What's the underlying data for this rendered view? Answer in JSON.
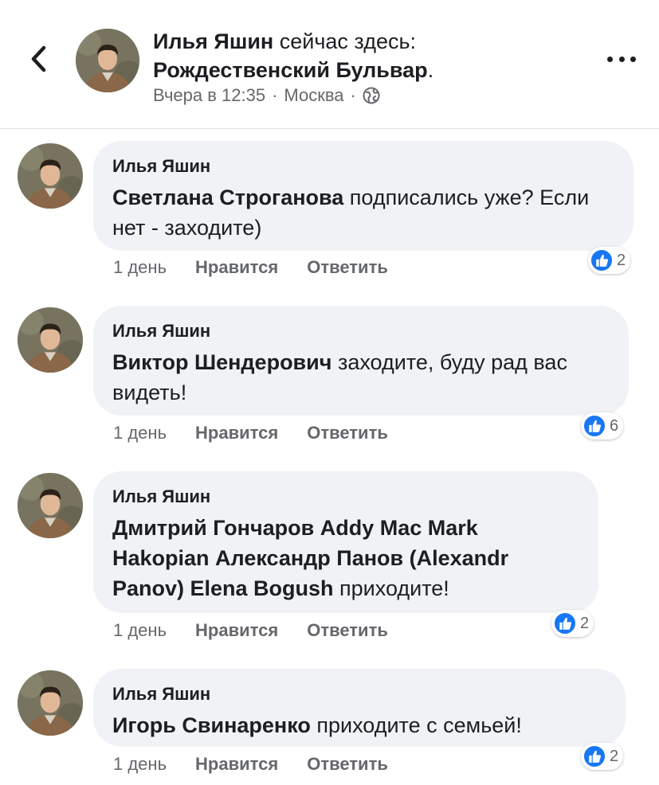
{
  "header": {
    "author": "Илья Яшин",
    "status_text": "сейчас здесь:",
    "place": "Рождественский Бульвар",
    "place_suffix": ".",
    "time": "Вчера в 12:35",
    "separator": "·",
    "location": "Москва",
    "icons": {
      "back": "chevron-left-icon",
      "privacy": "globe-icon",
      "more": "more-dots-icon"
    }
  },
  "comments": [
    {
      "author": "Илья Яшин",
      "mention": "Светлана Строганова",
      "text": " подписались уже? Если нет - заходите)",
      "time": "1 день",
      "like_label": "Нравится",
      "reply_label": "Ответить",
      "reactions": "2"
    },
    {
      "author": "Илья Яшин",
      "mention": "Виктор Шендерович",
      "text": " заходите, буду рад вас видеть!",
      "time": "1 день",
      "like_label": "Нравится",
      "reply_label": "Ответить",
      "reactions": "6"
    },
    {
      "author": "Илья Яшин",
      "mention": "Дмитрий Гончаров Addy Mac Mark Hakopian Александр Панов (Alexandr Panov) Elena Bogush",
      "text": " приходите!",
      "time": "1 день",
      "like_label": "Нравится",
      "reply_label": "Ответить",
      "reactions": "2"
    },
    {
      "author": "Илья Яшин",
      "mention": "Игорь Свинаренко",
      "text": " приходите с семьей!",
      "time": "1 день",
      "like_label": "Нравится",
      "reply_label": "Ответить",
      "reactions": "2"
    }
  ],
  "colors": {
    "bubble": "#f0f2f5",
    "secondary_text": "#65676b",
    "like_blue": "#1877f2",
    "divider": "#dddfe2"
  }
}
